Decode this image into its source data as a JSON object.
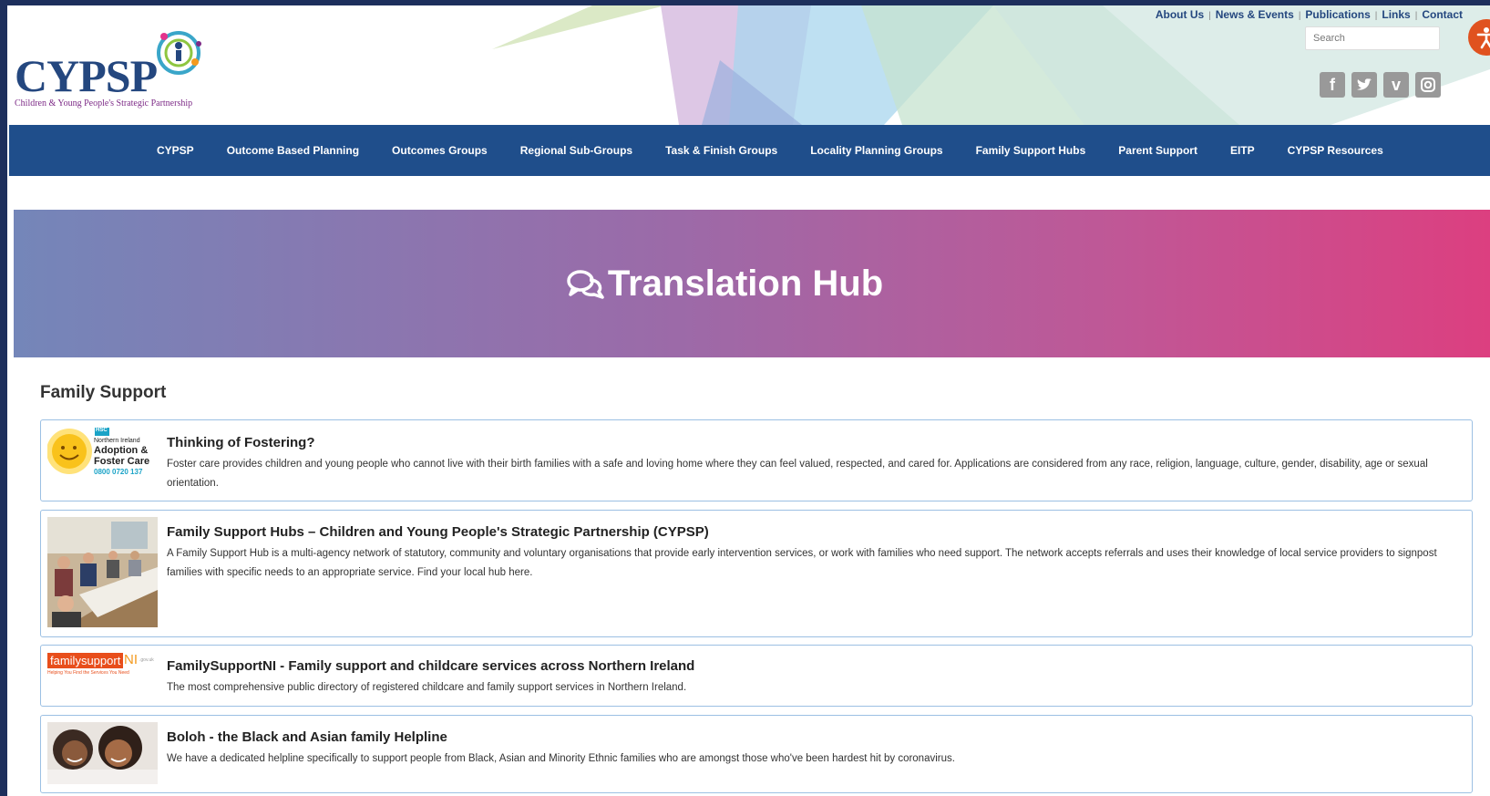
{
  "logo": {
    "text": "CYPSP",
    "tagline": "Children & Young People's Strategic Partnership"
  },
  "utility_links": [
    "About Us",
    "News & Events",
    "Publications",
    "Links",
    "Contact"
  ],
  "search": {
    "placeholder": "Search"
  },
  "social_icons": [
    "facebook-icon",
    "twitter-icon",
    "vimeo-icon",
    "instagram-icon"
  ],
  "nav": {
    "items": [
      "CYPSP",
      "Outcome Based Planning",
      "Outcomes Groups",
      "Regional Sub-Groups",
      "Task & Finish Groups",
      "Locality Planning Groups",
      "Family Support Hubs",
      "Parent Support",
      "EITP",
      "CYPSP Resources"
    ]
  },
  "banner": {
    "title": "Translation Hub"
  },
  "section": {
    "title": "Family Support"
  },
  "cards": [
    {
      "title": "Thinking of Fostering?",
      "description": "Foster care provides children and young people who cannot live with their birth families with a safe and loving home where they can feel valued, respected, and cared for. Applications are considered from any race, religion, language, culture, gender, disability, age or sexual orientation.",
      "thumb": {
        "badge": "HSC",
        "org": "Northern Ireland",
        "line1": "Adoption &",
        "line2": "Foster Care",
        "phone": "0800 0720 137"
      }
    },
    {
      "title": "Family Support Hubs – Children and Young People's Strategic Partnership (CYPSP)",
      "description": "A Family Support Hub is a multi-agency network of statutory, community and voluntary organisations that provide early intervention services, or work with families who need support. The network accepts referrals and uses their knowledge of local service providers to signpost families with specific needs to an appropriate service. Find your local hub here."
    },
    {
      "title": "FamilySupportNI - Family support and childcare services across Northern Ireland",
      "description": "The most comprehensive public directory of registered childcare and family support services in Northern Ireland.",
      "thumb": {
        "brand": "familysupport",
        "suffix": "NI",
        "domain": ".gov.uk",
        "tagline": "Helping You Find the Services You Need"
      }
    },
    {
      "title": "Boloh - the Black and Asian family Helpline",
      "description": "We have a dedicated helpline specifically to support people from Black, Asian and Minority Ethnic families who are amongst those who've been hardest hit by coronavirus."
    }
  ],
  "colors": {
    "nav_bg": "#1f4e8b",
    "link": "#24477f",
    "banner_start": "#7486b9",
    "banner_end": "#dc3f80",
    "card_border": "#9cc0e3",
    "accessibility": "#e0521f"
  }
}
